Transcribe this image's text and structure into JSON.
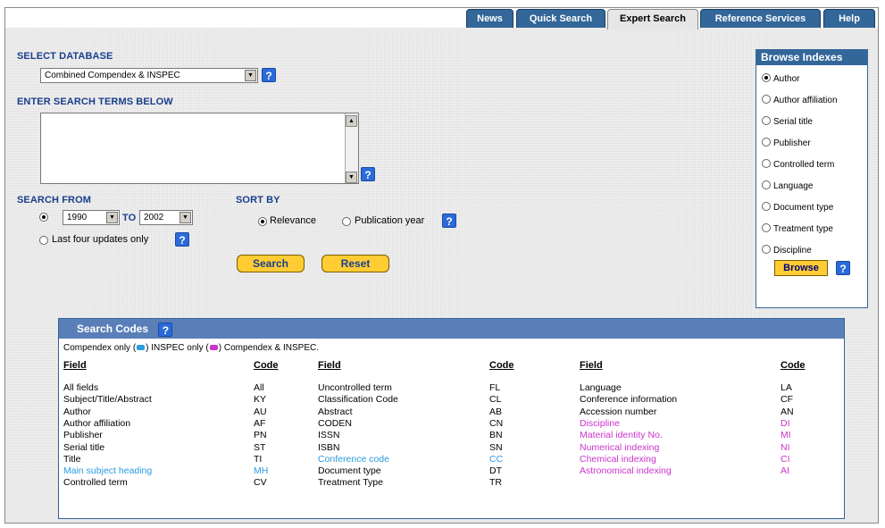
{
  "tabs": [
    "News",
    "Quick Search",
    "Expert Search",
    "Reference Services",
    "Help"
  ],
  "active_tab": "Expert Search",
  "select_database": {
    "label": "SELECT DATABASE",
    "value": "Combined Compendex & INSPEC"
  },
  "search_terms": {
    "label": "ENTER SEARCH TERMS BELOW",
    "value": ""
  },
  "search_from": {
    "label": "SEARCH FROM",
    "from_year": "1990",
    "to_label": "TO",
    "to_year": "2002",
    "last_four_label": "Last four updates only"
  },
  "sort_by": {
    "label": "SORT BY",
    "relevance": "Relevance",
    "publication_year": "Publication year"
  },
  "buttons": {
    "search": "Search",
    "reset": "Reset",
    "browse": "Browse"
  },
  "help_glyph": "?",
  "browse_indexes": {
    "title": "Browse Indexes",
    "items": [
      "Author",
      "Author affiliation",
      "Serial title",
      "Publisher",
      "Controlled term",
      "Language",
      "Document type",
      "Treatment type",
      "Discipline"
    ]
  },
  "search_codes": {
    "title": "Search Codes",
    "legend": {
      "a": "Compendex only (",
      "b": ") INSPEC only (",
      "c": ") Compendex & INSPEC."
    },
    "headers": {
      "field": "Field",
      "code": "Code"
    },
    "col1": [
      {
        "field": "All fields",
        "code": "All",
        "db": "both"
      },
      {
        "field": "Subject/Title/Abstract",
        "code": "KY",
        "db": "both"
      },
      {
        "field": "Author",
        "code": "AU",
        "db": "both"
      },
      {
        "field": "Author affiliation",
        "code": "AF",
        "db": "both"
      },
      {
        "field": "Publisher",
        "code": "PN",
        "db": "both"
      },
      {
        "field": "Serial title",
        "code": "ST",
        "db": "both"
      },
      {
        "field": "Title",
        "code": "TI",
        "db": "both"
      },
      {
        "field": "Main subject heading",
        "code": "MH",
        "db": "compendex"
      },
      {
        "field": "Controlled term",
        "code": "CV",
        "db": "both"
      }
    ],
    "col2": [
      {
        "field": "Uncontrolled term",
        "code": "FL",
        "db": "both"
      },
      {
        "field": "Classification Code",
        "code": "CL",
        "db": "both"
      },
      {
        "field": "Abstract",
        "code": "AB",
        "db": "both"
      },
      {
        "field": "CODEN",
        "code": "CN",
        "db": "both"
      },
      {
        "field": "ISSN",
        "code": "BN",
        "db": "both"
      },
      {
        "field": "ISBN",
        "code": "SN",
        "db": "both"
      },
      {
        "field": "Conference code",
        "code": "CC",
        "db": "compendex"
      },
      {
        "field": "Document type",
        "code": "DT",
        "db": "both"
      },
      {
        "field": "Treatment Type",
        "code": "TR",
        "db": "both"
      }
    ],
    "col3": [
      {
        "field": "Language",
        "code": "LA",
        "db": "both"
      },
      {
        "field": "Conference information",
        "code": "CF",
        "db": "both"
      },
      {
        "field": "Accession number",
        "code": "AN",
        "db": "both"
      },
      {
        "field": "Discipline",
        "code": "DI",
        "db": "inspec"
      },
      {
        "field": "Material identity No.",
        "code": "MI",
        "db": "inspec"
      },
      {
        "field": "Numerical indexing",
        "code": "NI",
        "db": "inspec"
      },
      {
        "field": "Chemical indexing",
        "code": "CI",
        "db": "inspec"
      },
      {
        "field": "Astronomical indexing",
        "code": "AI",
        "db": "inspec"
      }
    ]
  },
  "colors": {
    "tab_blue": "#336699",
    "label_blue": "#1a3f8c",
    "compendex": "#2a9be0",
    "inspec": "#cc33cc",
    "both": "#000000",
    "button_yellow": "#ffcc33"
  }
}
